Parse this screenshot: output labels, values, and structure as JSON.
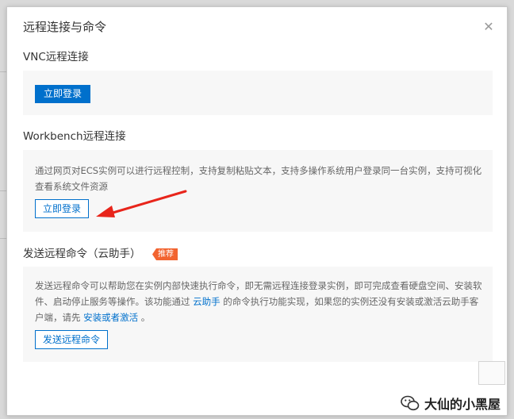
{
  "dialog": {
    "title": "远程连接与命令",
    "close_icon": "close-icon"
  },
  "vnc": {
    "title": "VNC远程连接",
    "login_button": "立即登录"
  },
  "workbench": {
    "title": "Workbench远程连接",
    "description": "通过网页对ECS实例可以进行远程控制，支持复制粘贴文本，支持多操作系统用户登录同一台实例，支持可视化查看系统文件资源",
    "login_button": "立即登录"
  },
  "command": {
    "title": "发送远程命令（云助手）",
    "badge": "推荐",
    "desc_part1": "发送远程命令可以帮助您在实例内部快速执行命令，即无需远程连接登录实例，即可完成查看硬盘空间、安装软件、启动停止服务等操作。该功能通过 ",
    "desc_link1": "云助手",
    "desc_part2": " 的命令执行功能实现，如果您的实例还没有安装或激活云助手客户端，请先 ",
    "desc_link2": "安装或者激活",
    "desc_part3": " 。",
    "send_button": "发送远程命令"
  },
  "watermark": {
    "text": "大仙的小黑屋",
    "icon": "wechat-icon"
  },
  "colors": {
    "primary": "#0070cc",
    "badge": "#f26430",
    "arrow": "#e8251b",
    "panel_bg": "#f7f7f7"
  }
}
